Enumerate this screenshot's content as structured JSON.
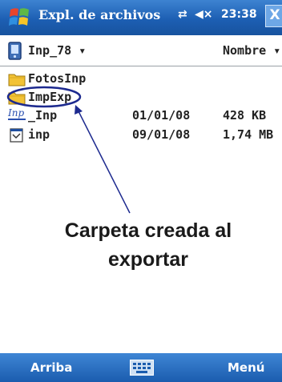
{
  "titlebar": {
    "app_title": "Expl. de archivos",
    "time": "23:38",
    "close_label": "X",
    "sync_glyph": "⇄",
    "volume_glyph": "◀×"
  },
  "pathbar": {
    "current_folder": "Inp_78",
    "dropdown_glyph": "▾",
    "sort_label": "Nombre",
    "sort_glyph": "▾"
  },
  "files": [
    {
      "name": "FotosInp",
      "date": "",
      "size": "",
      "icon": "folder-icon"
    },
    {
      "name": "ImpExp",
      "date": "",
      "size": "",
      "icon": "folder-icon"
    },
    {
      "name": "_Inp",
      "date": "01/01/08",
      "size": "428 KB",
      "icon": "inp-document-icon",
      "icon_text": "Inp"
    },
    {
      "name": "inp",
      "date": "09/01/08",
      "size": "1,74 MB",
      "icon": "application-icon"
    }
  ],
  "annotation": {
    "line1": "Carpeta creada al",
    "line2": "exportar",
    "color": "#1d2a8f"
  },
  "menubar": {
    "left_softkey": "Arriba",
    "right_softkey": "Menú",
    "keyboard_icon": "keyboard-icon"
  },
  "colors": {
    "title_blue": "#1d5fb3",
    "folder_yellow": "#f2c236",
    "annotation_blue": "#1d2a8f"
  }
}
